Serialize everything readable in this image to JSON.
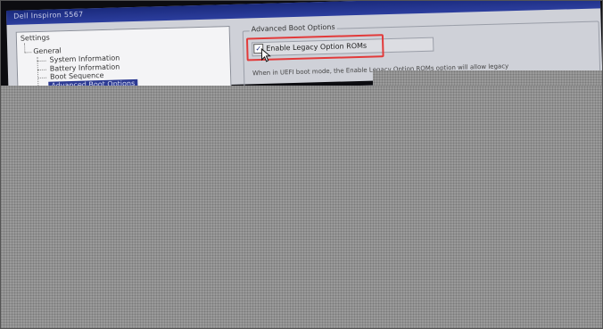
{
  "window": {
    "title": "Dell Inspiron 5567"
  },
  "tree": {
    "root": "Settings",
    "group": "General",
    "items": [
      {
        "label": "System Information",
        "selected": false
      },
      {
        "label": "Battery Information",
        "selected": false
      },
      {
        "label": "Boot Sequence",
        "selected": false
      },
      {
        "label": "Advanced Boot Options",
        "selected": true
      }
    ]
  },
  "options": {
    "group_title": "Advanced Boot Options",
    "legacy_rom": {
      "label": "Enable Legacy Option ROMs",
      "checked": true,
      "check_glyph": "✓"
    },
    "help": "When in UEFI boot mode, the Enable Legacy Option ROMs option will allow legacy"
  },
  "colors": {
    "title_bar": "#1a2a7c",
    "selection": "#2d3b93",
    "highlight_box": "#e23a3a",
    "screen_bg": "#cfd1d8",
    "mask": "#9a9a9a"
  }
}
